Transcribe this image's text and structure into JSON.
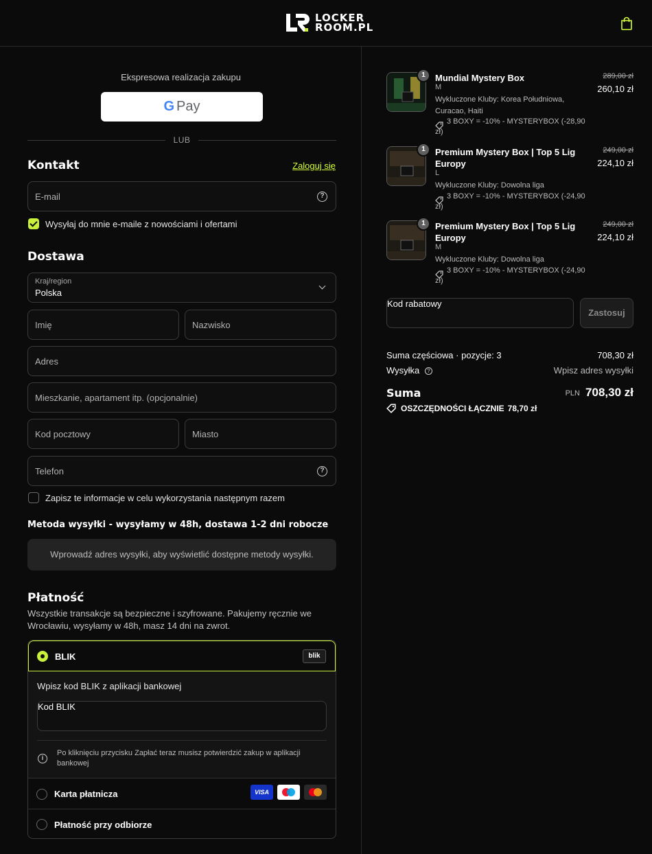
{
  "header": {
    "logo_line1": "LOCKER",
    "logo_line2": "ROOM.PL"
  },
  "express": {
    "title": "Ekspresowa realizacja zakupu",
    "gpay_label": "Pay",
    "or_label": "LUB"
  },
  "contact": {
    "title": "Kontakt",
    "login_link": "Zaloguj się",
    "email_placeholder": "E-mail",
    "newsletter_label": "Wysyłaj do mnie e-maile z nowościami i ofertami"
  },
  "delivery": {
    "title": "Dostawa",
    "country_label": "Kraj/region",
    "country_value": "Polska",
    "first_name": "Imię",
    "last_name": "Nazwisko",
    "address": "Adres",
    "apartment": "Mieszkanie, apartament itp. (opcjonalnie)",
    "postal_code": "Kod pocztowy",
    "city": "Miasto",
    "phone": "Telefon",
    "save_info_label": "Zapisz te informacje w celu wykorzystania następnym razem"
  },
  "shipping": {
    "title": "Metoda wysyłki - wysyłamy w 48h, dostawa 1-2 dni robocze",
    "notice": "Wprowadź adres wysyłki, aby wyświetlić dostępne metody wysyłki."
  },
  "payment": {
    "title": "Płatność",
    "subtitle": "Wszystkie transakcje są bezpieczne i szyfrowane. Pakujemy ręcznie we Wrocławiu, wysyłamy w 48h, masz 14 dni na zwrot.",
    "blik_label": "BLIK",
    "blik_logo": "blik",
    "blik_instruction": "Wpisz kod BLIK z aplikacji bankowej",
    "blik_placeholder": "Kod BLIK",
    "blik_info": "Po kliknięciu przycisku Zapłać teraz musisz potwierdzić zakup w aplikacji bankowej",
    "card_label": "Karta płatnicza",
    "visa_label": "VISA",
    "cod_label": "Płatność przy odbiorze"
  },
  "cart": {
    "items": [
      {
        "qty": "1",
        "name": "Mundial Mystery Box",
        "variant": "M",
        "excluded": "Wykluczone Kluby: Korea Południowa, Curacao, Haiti",
        "discount": "3 BOXY = -10% - MYSTERYBOX (-28,90 zł)",
        "price_old": "289,00 zł",
        "price_new": "260,10 zł"
      },
      {
        "qty": "1",
        "name": "Premium Mystery Box | Top 5 Lig Europy",
        "variant": "L",
        "excluded": "Wykluczone Kluby: Dowolna liga",
        "discount": "3 BOXY = -10% - MYSTERYBOX (-24,90 zł)",
        "price_old": "249,00 zł",
        "price_new": "224,10 zł"
      },
      {
        "qty": "1",
        "name": "Premium Mystery Box | Top 5 Lig Europy",
        "variant": "M",
        "excluded": "Wykluczone Kluby: Dowolna liga",
        "discount": "3 BOXY = -10% - MYSTERYBOX (-24,90 zł)",
        "price_old": "249,00 zł",
        "price_new": "224,10 zł"
      }
    ],
    "discount_placeholder": "Kod rabatowy",
    "apply_label": "Zastosuj",
    "subtotal_label": "Suma częściowa · pozycje: 3",
    "subtotal_value": "708,30 zł",
    "shipping_label": "Wysyłka",
    "shipping_value": "Wpisz adres wysyłki",
    "total_label": "Suma",
    "total_currency": "PLN",
    "total_value": "708,30 zł",
    "savings_label": "OSZCZĘDNOŚCI ŁĄCZNIE",
    "savings_value": "78,70 zł"
  },
  "colors": {
    "accent": "#c9f03a",
    "background": "#0b0b0b",
    "link": "#d4ff3a"
  }
}
